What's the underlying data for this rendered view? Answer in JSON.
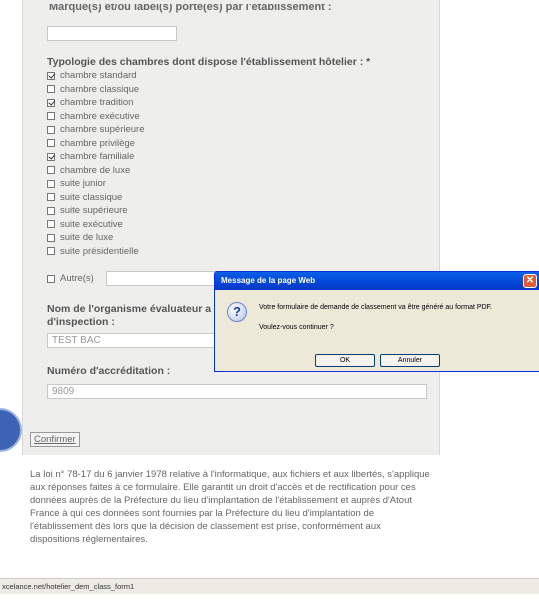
{
  "form": {
    "brand_label_cut": "Marque(s) et/ou label(s) porté(es) par l'établissement :",
    "brand_value": "",
    "room_types_title": "Typologie des chambres dont dispose l'établissement hôtelier : *",
    "room_types": [
      {
        "label": "chambre standard",
        "checked": true
      },
      {
        "label": "chambre classique",
        "checked": false
      },
      {
        "label": "chambre tradition",
        "checked": true
      },
      {
        "label": "chambre exécutive",
        "checked": false
      },
      {
        "label": "chambre supérieure",
        "checked": false
      },
      {
        "label": "chambre privilège",
        "checked": false
      },
      {
        "label": "chambre familiale",
        "checked": true
      },
      {
        "label": "chambre de luxe",
        "checked": false
      },
      {
        "label": "suite junior",
        "checked": false
      },
      {
        "label": "suite classique",
        "checked": false
      },
      {
        "label": "suite supérieure",
        "checked": false
      },
      {
        "label": "suite exécutive",
        "checked": false
      },
      {
        "label": "suite de luxe",
        "checked": false
      },
      {
        "label": "suite présidentielle",
        "checked": false
      }
    ],
    "other_label": "Autre(s)",
    "org_title_line1": "Nom de l'organisme évaluateur a",
    "org_title_line2": "d'inspection :",
    "org_value": "TEST BAC",
    "accred_title": "Numéro d'accréditation :",
    "accred_value": "9809"
  },
  "confirm_label": "Confirmer",
  "law_text": "La loi n° 78-17 du 6 janvier 1978 relative à l'informatique, aux fichiers et aux libertés, s'applique aux réponses faites à ce formulaire. Elle garantit un droit d'accès et de rectification pour ces données auprès de la Préfecture du lieu d'implantation de l'établissement et auprès d'Atout France à qui ces données sont fournies par la Préfecture du lieu d'implantation de l'établissement dès lors que la décision de classement est prise, conformément aux dispositions réglementaires.",
  "status_url": "xcelance.net/hotelier_dem_class_form1",
  "dialog": {
    "title": "Message de la page Web",
    "message": "Votre formulaire de demande de classement va être généré au format PDF.",
    "question": "Voulez-vous continuer ?",
    "ok_label": "OK",
    "cancel_label": "Annuler",
    "icon": "question-icon"
  },
  "colors": {
    "panel_bg": "#eeeeec",
    "dialog_title_blue": "#0345d6",
    "close_red": "#e05b37",
    "circle_blue": "#3d63b4"
  }
}
